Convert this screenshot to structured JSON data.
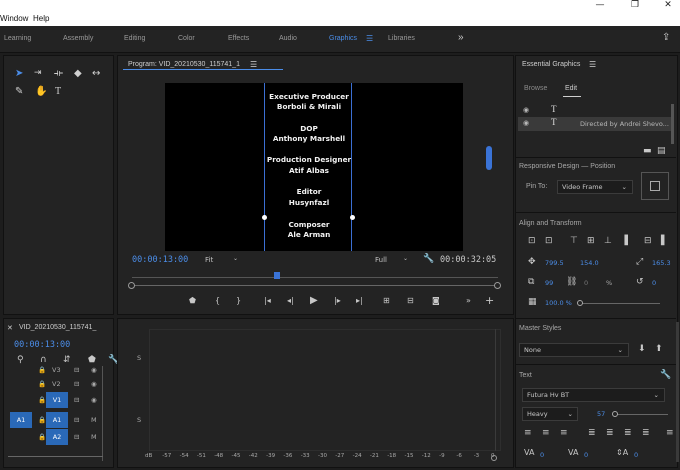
{
  "menubar": {
    "items": [
      "Window",
      "Help"
    ],
    "controls": [
      "—",
      "❐",
      "✕"
    ]
  },
  "workspaces": {
    "tabs": [
      "Learning",
      "Assembly",
      "Editing",
      "Color",
      "Effects",
      "Audio",
      "Graphics",
      "Libraries"
    ],
    "active": "Graphics",
    "more": "»"
  },
  "program": {
    "title": "Program: VID_20210530_115741_1",
    "credits": [
      {
        "role": "Executive Producer",
        "name": "Borboli & Mirali"
      },
      {
        "role": "DOP",
        "name": "Anthony Marshell"
      },
      {
        "role": "Production Designer",
        "name": "Atif Albas"
      },
      {
        "role": "Editor",
        "name": "Husynfazl"
      },
      {
        "role": "Composer",
        "name": "Ale Arman"
      }
    ],
    "current_time": "00:00:13:00",
    "fit": "Fit",
    "resolution": "Full",
    "duration": "00:00:32:05"
  },
  "timeline": {
    "title": "VID_20210530_115741_",
    "current_time": "00:00:13:00",
    "tracks": [
      {
        "label": "V3"
      },
      {
        "label": "V2"
      },
      {
        "label": "V1"
      },
      {
        "label": "A1",
        "source": "A1",
        "mute": "M"
      },
      {
        "label": "A2",
        "mute": "M"
      }
    ],
    "solo_label": "S",
    "meter_scale": [
      "dB",
      "-57",
      "-54",
      "-51",
      "-48",
      "-45",
      "-42",
      "-39",
      "-36",
      "-33",
      "-30",
      "-27",
      "-24",
      "-21",
      "-18",
      "-15",
      "-12",
      "-9",
      "-6",
      "-3",
      "0"
    ]
  },
  "essential_graphics": {
    "title": "Essential Graphics",
    "tabs": [
      "Browse",
      "Edit"
    ],
    "active_tab": "Edit",
    "layers": [
      {
        "name": ""
      },
      {
        "name": "Directed by Andrei Shevo..."
      }
    ],
    "responsive_design": "Responsive Design — Position",
    "pin_to_label": "Pin To:",
    "pin_to_value": "Video Frame",
    "align_title": "Align and Transform",
    "pos_x": "799.5",
    "pos_y": "154.0",
    "anchor": "165.3",
    "scale": "99",
    "opacity": "0",
    "opacity_unit": "%",
    "rotation": "0",
    "scale_pct": "100.0 %",
    "master_styles": "Master Styles",
    "master_style_value": "None",
    "text_title": "Text",
    "font": "Futura Hv BT",
    "weight": "Heavy",
    "size": "57",
    "tracking": "0",
    "leading": "0",
    "kerning": "0"
  },
  "colors": {
    "accent": "#4b8de8",
    "track_blue": "#2a69b8",
    "panel": "#232323",
    "playhead": "#e6c547"
  }
}
